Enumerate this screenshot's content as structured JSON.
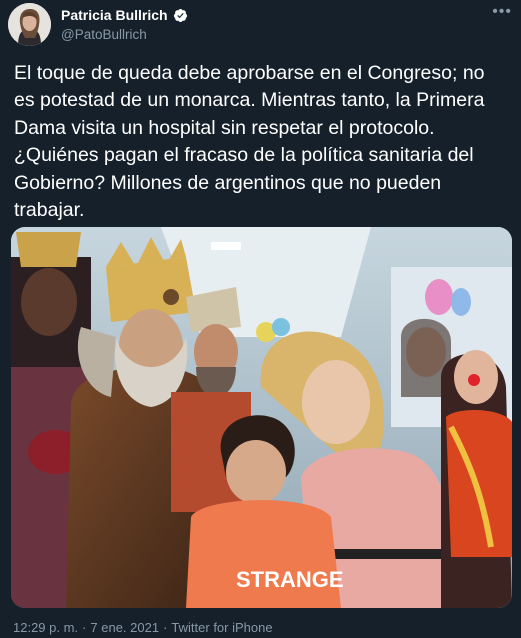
{
  "author": {
    "display_name": "Patricia Bullrich",
    "handle": "@PatoBullrich",
    "verified_icon": "verified-badge-icon",
    "more_icon": "more-dots-icon"
  },
  "tweet": {
    "text": "El toque de queda debe aprobarse  en el Congreso; no\nes potestad de un monarca. Mientras tanto, la Primera\nDama visita un hospital sin respetar el protocolo.\n¿Quiénes pagan el fracaso de la política sanitaria del\nGobierno? Millones de argentinos que no pueden\ntrabajar.",
    "photo_shirt_text": "STRANGE"
  },
  "meta": {
    "time": "12:29 p. m.",
    "sep1": "·",
    "date": "7 ene. 2021",
    "sep2": "·",
    "source": "Twitter for iPhone"
  },
  "colors": {
    "background": "#15202b",
    "text_primary": "#ffffff",
    "text_secondary": "#8899a6",
    "verified": "#ffffff"
  }
}
